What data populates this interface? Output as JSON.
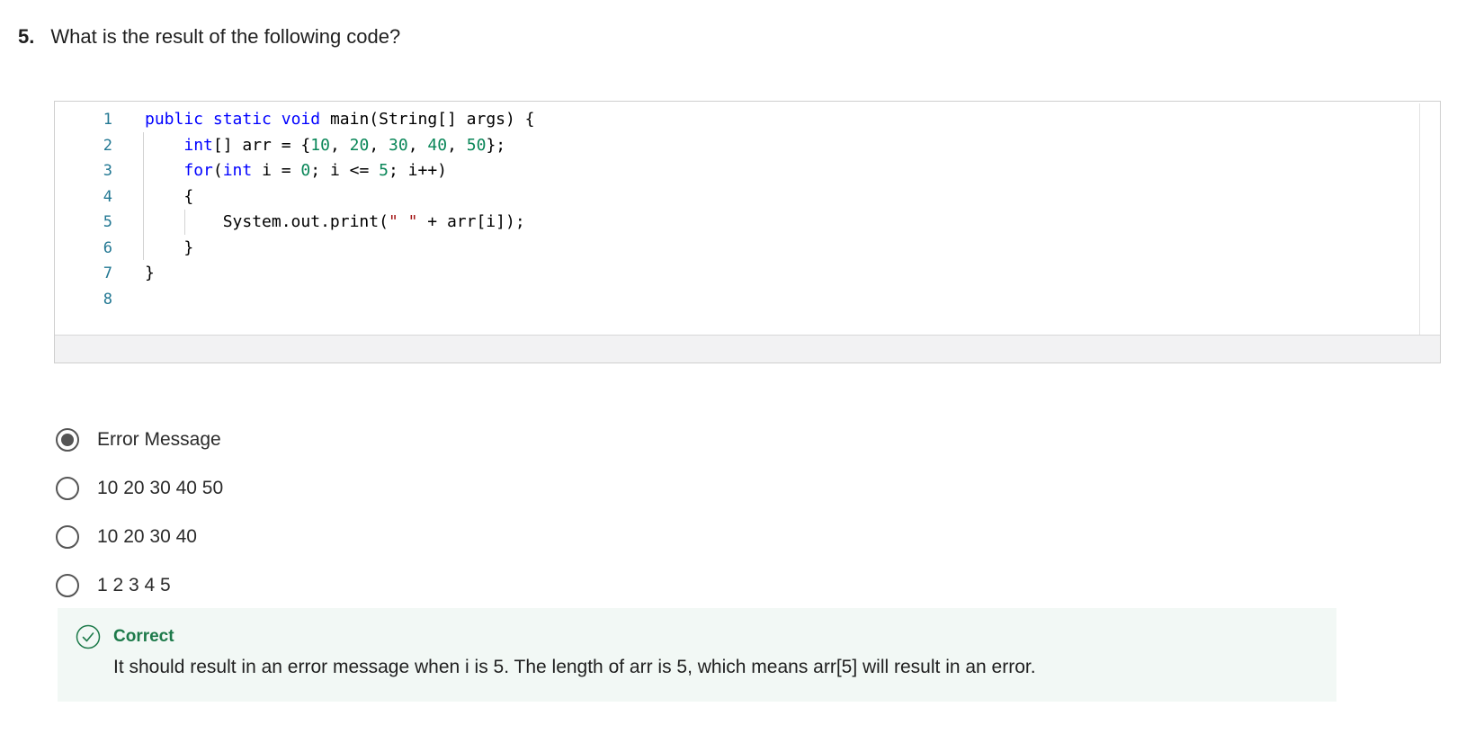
{
  "question": {
    "number": "5.",
    "text": "What is the result of the following code?"
  },
  "code": {
    "line_numbers": [
      "1",
      "2",
      "3",
      "4",
      "5",
      "6",
      "7",
      "8"
    ],
    "lines": [
      [
        {
          "t": "public",
          "c": "kw"
        },
        {
          "t": " "
        },
        {
          "t": "static",
          "c": "kw"
        },
        {
          "t": " "
        },
        {
          "t": "void",
          "c": "kw"
        },
        {
          "t": " main(String[] args) {"
        }
      ],
      [
        {
          "t": "    "
        },
        {
          "t": "int",
          "c": "kw"
        },
        {
          "t": "[] arr = {"
        },
        {
          "t": "10",
          "c": "num"
        },
        {
          "t": ", "
        },
        {
          "t": "20",
          "c": "num"
        },
        {
          "t": ", "
        },
        {
          "t": "30",
          "c": "num"
        },
        {
          "t": ", "
        },
        {
          "t": "40",
          "c": "num"
        },
        {
          "t": ", "
        },
        {
          "t": "50",
          "c": "num"
        },
        {
          "t": "};"
        }
      ],
      [
        {
          "t": "    "
        },
        {
          "t": "for",
          "c": "kw"
        },
        {
          "t": "("
        },
        {
          "t": "int",
          "c": "kw"
        },
        {
          "t": " i = "
        },
        {
          "t": "0",
          "c": "num"
        },
        {
          "t": "; i <= "
        },
        {
          "t": "5",
          "c": "num"
        },
        {
          "t": "; i++)"
        }
      ],
      [
        {
          "t": "    {"
        }
      ],
      [
        {
          "t": "        System.out.print("
        },
        {
          "t": "\" \"",
          "c": "str"
        },
        {
          "t": " + arr[i]);"
        }
      ],
      [
        {
          "t": "    }"
        }
      ],
      [
        {
          "t": "}"
        }
      ],
      [
        {
          "t": ""
        }
      ]
    ]
  },
  "answers": [
    {
      "label": "Error Message",
      "selected": true
    },
    {
      "label": "10 20 30 40 50",
      "selected": false
    },
    {
      "label": "10 20 30 40",
      "selected": false
    },
    {
      "label": "1 2 3 4 5",
      "selected": false
    }
  ],
  "feedback": {
    "icon": "check-circle-icon",
    "title": "Correct",
    "text": "It should result in an error message when i is 5. The length of arr is 5, which means arr[5] will result in an error.",
    "color": "#1d7a4a"
  }
}
